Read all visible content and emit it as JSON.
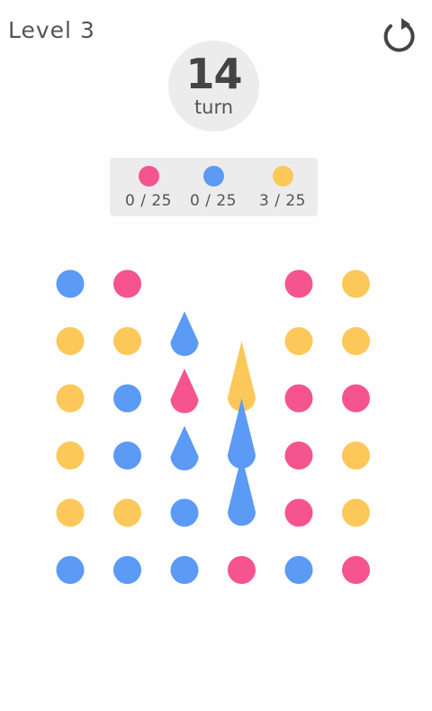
{
  "header": {
    "level_label": "Level 3",
    "restart_icon": "restart-icon"
  },
  "turn": {
    "count": "14",
    "label": "turn"
  },
  "colors": {
    "pink": "#f5548e",
    "blue": "#5b9af5",
    "yellow": "#fdc85a"
  },
  "goals": [
    {
      "color": "pink",
      "count": "0 / 25"
    },
    {
      "color": "blue",
      "count": "0 / 25"
    },
    {
      "color": "yellow",
      "count": "3 / 25"
    }
  ],
  "board": {
    "columns": 6,
    "rows": 6,
    "cells": [
      [
        "blue",
        "pink",
        null,
        null,
        "pink",
        "yellow"
      ],
      [
        "yellow",
        "yellow",
        "drop:blue",
        null,
        "yellow",
        "yellow"
      ],
      [
        "yellow",
        "blue",
        "drop:pink",
        null,
        "pink",
        "pink"
      ],
      [
        "yellow",
        "blue",
        "drop:blue",
        null,
        "pink",
        "yellow"
      ],
      [
        "yellow",
        "yellow",
        "blue",
        null,
        "pink",
        "yellow"
      ],
      [
        "blue",
        "blue",
        "blue",
        "pink",
        "blue",
        "pink"
      ]
    ],
    "falling": [
      {
        "color": "yellow",
        "column": 3,
        "from_row": 1,
        "to_row": 2
      },
      {
        "color": "blue",
        "column": 3,
        "from_row": 2,
        "to_row": 3
      },
      {
        "color": "blue",
        "column": 3,
        "from_row": 3,
        "to_row": 4
      }
    ]
  }
}
